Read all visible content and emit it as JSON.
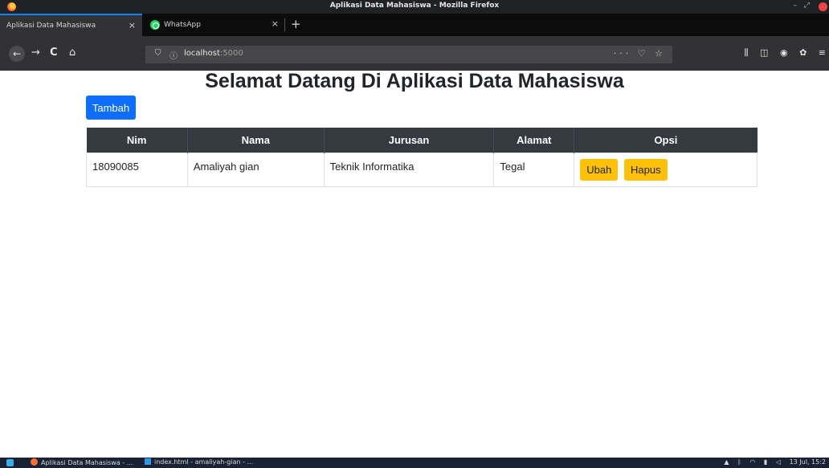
{
  "window": {
    "title": "Aplikasi Data Mahasiswa - Mozilla Firefox"
  },
  "tabs": [
    {
      "label": "Aplikasi Data Mahasiswa",
      "close": "×"
    },
    {
      "label": "WhatsApp",
      "close": "×"
    }
  ],
  "newtab": "+",
  "nav": {
    "back": "←",
    "forward": "→",
    "reload": "C",
    "home": "⌂",
    "url_host": "localhost",
    "url_port": ":5000",
    "page_tools": "··· ♡ ☆"
  },
  "page": {
    "heading": "Selamat Datang Di Aplikasi Data Mahasiswa",
    "add_button": "Tambah",
    "table": {
      "headers": [
        "Nim",
        "Nama",
        "Jurusan",
        "Alamat",
        "Opsi"
      ],
      "rows": [
        {
          "nim": "18090085",
          "nama": "Amaliyah gian",
          "jurusan": "Teknik Informatika",
          "alamat": "Tegal",
          "edit": "Ubah",
          "delete": "Hapus"
        }
      ]
    }
  },
  "taskbar": {
    "task1": "Aplikasi Data Mahasiswa - ...",
    "task2": "index.html - amaliyah-gian - ...",
    "clock": "13 Jul, 15:2"
  }
}
